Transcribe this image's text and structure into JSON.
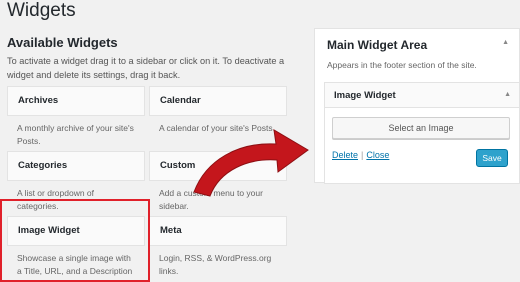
{
  "header": {
    "title": "Widgets"
  },
  "available": {
    "title": "Available Widgets",
    "description": "To activate a widget drag it to a sidebar or click on it. To deactivate a widget and delete its settings, drag it back."
  },
  "widgets": [
    {
      "name": "Archives",
      "desc": "A monthly archive of your site's Posts."
    },
    {
      "name": "Calendar",
      "desc": "A calendar of your site's Posts."
    },
    {
      "name": "Categories",
      "desc": "A list or dropdown of categories."
    },
    {
      "name": "Custom",
      "desc": "Add a custom menu to your sidebar."
    },
    {
      "name": "Image Widget",
      "desc": "Showcase a single image with a Title, URL, and a Description"
    },
    {
      "name": "Meta",
      "desc": "Login, RSS, & WordPress.org links."
    }
  ],
  "sidebar": {
    "title": "Main Widget Area",
    "description": "Appears in the footer section of the site.",
    "widget": {
      "title": "Image Widget",
      "select_label": "Select an Image",
      "delete_label": "Delete",
      "separator": "|",
      "close_label": "Close",
      "save_label": "Save"
    }
  },
  "colors": {
    "highlight": "#e0202a",
    "arrow": "#c4161c",
    "link": "#0073aa",
    "save_button": "#2ea2cc"
  },
  "icons": {
    "collapse": "triangle-up-icon",
    "arrow": "curved-arrow-icon"
  }
}
